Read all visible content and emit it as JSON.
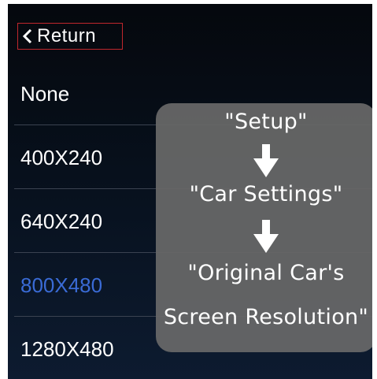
{
  "header": {
    "return_label": "Return"
  },
  "resolution_list": {
    "items": [
      {
        "label": "None",
        "selected": false
      },
      {
        "label": "400X240",
        "selected": false
      },
      {
        "label": "640X240",
        "selected": false
      },
      {
        "label": "800X480",
        "selected": true
      },
      {
        "label": "1280X480",
        "selected": false
      }
    ]
  },
  "instructions": {
    "step1": "\"Setup\"",
    "step2": "\"Car Settings\"",
    "step3_line1": "\"Original Car's",
    "step3_line2": "Screen Resolution\""
  },
  "colors": {
    "return_border": "#c0272d",
    "selected_text": "#3a6bd6",
    "overlay_bg": "#686868"
  }
}
